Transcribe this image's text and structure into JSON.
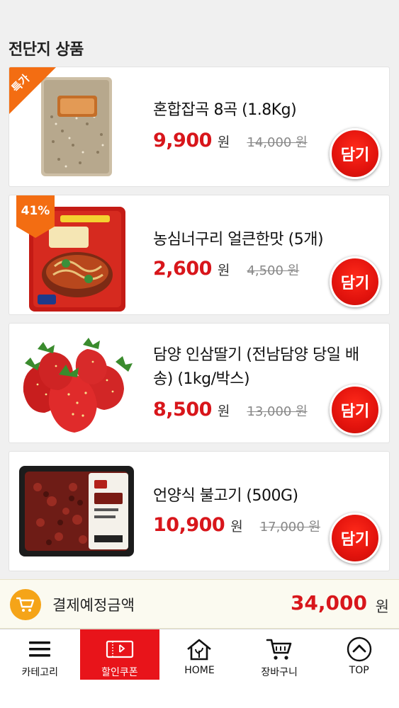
{
  "section_title": "전단지 상품",
  "products": [
    {
      "name": "혼합잡곡 8곡 (1.8Kg)",
      "price": "9,900",
      "currency": "원",
      "original_price": "14,000 원",
      "button": "담기",
      "badge": "특가",
      "badge_type": "corner"
    },
    {
      "name": "농심너구리 얼큰한맛 (5개)",
      "price": "2,600",
      "currency": "원",
      "original_price": "4,500 원",
      "button": "담기",
      "badge": "41%",
      "badge_type": "percent"
    },
    {
      "name": "담양 인삼딸기 (전남담양 당일 배송) (1kg/박스)",
      "price": "8,500",
      "currency": "원",
      "original_price": "13,000 원",
      "button": "담기"
    },
    {
      "name": "언양식 불고기 (500G)",
      "price": "10,900",
      "currency": "원",
      "original_price": "17,000 원",
      "button": "담기"
    }
  ],
  "total": {
    "label": "결제예정금액",
    "amount": "34,000",
    "unit": "원",
    "icon": "cart-icon"
  },
  "bottom_nav": [
    {
      "label": "카테고리",
      "icon": "menu-icon",
      "active": false
    },
    {
      "label": "할인쿠폰",
      "icon": "coupon-icon",
      "active": true
    },
    {
      "label": "HOME",
      "icon": "home-icon",
      "active": false
    },
    {
      "label": "장바구니",
      "icon": "cart-icon",
      "active": false
    },
    {
      "label": "TOP",
      "icon": "chevron-up-icon",
      "active": false
    }
  ],
  "colors": {
    "accent_red": "#d8161b",
    "badge_orange": "#f36d12",
    "cart_orange": "#f5a418"
  }
}
